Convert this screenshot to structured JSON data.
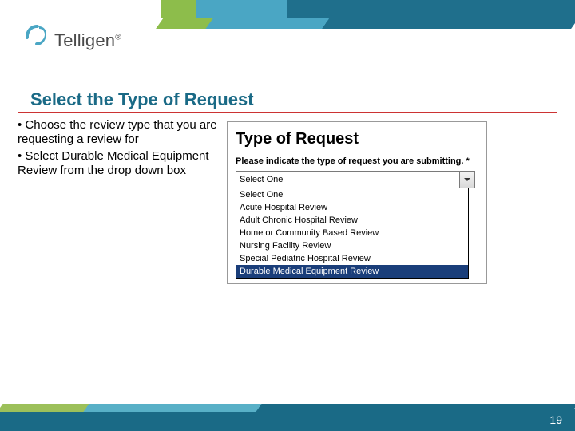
{
  "logo": {
    "brand": "Telligen",
    "reg": "®"
  },
  "heading": "Select the Type of Request",
  "bullets": [
    "Choose the review type that you are requesting a review for",
    "Select Durable Medical Equipment Review from the drop down box"
  ],
  "shot": {
    "title": "Type of Request",
    "prompt": "Please indicate the type of request you are submitting. *",
    "selected": "Select One",
    "options": [
      "Select One",
      "Acute Hospital Review",
      "Adult Chronic Hospital Review",
      "Home or Community Based Review",
      "Nursing Facility Review",
      "Special Pediatric Hospital Review",
      "Durable Medical Equipment Review"
    ],
    "highlight_index": 6
  },
  "page_number": "19"
}
